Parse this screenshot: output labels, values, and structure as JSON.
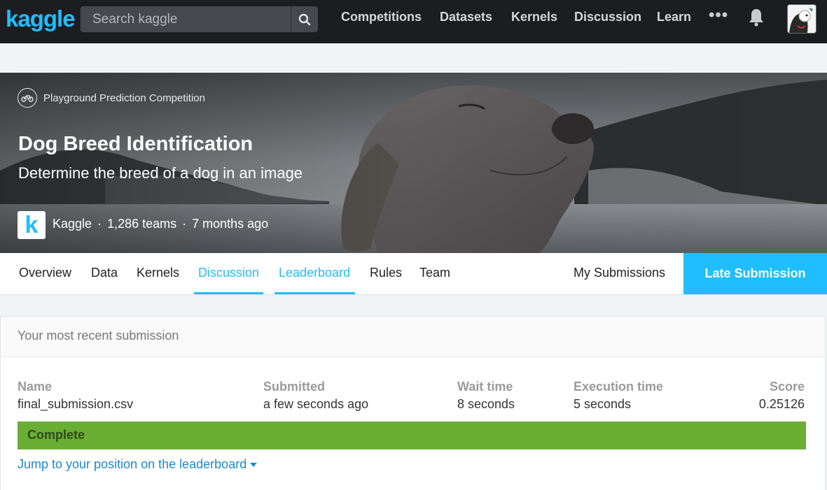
{
  "nav": {
    "logo": "kaggle",
    "search_placeholder": "Search kaggle",
    "links": [
      "Competitions",
      "Datasets",
      "Kernels",
      "Discussion",
      "Learn"
    ],
    "more": "•••"
  },
  "competition": {
    "type": "Playground Prediction Competition",
    "title": "Dog Breed Identification",
    "subtitle": "Determine the breed of a dog in an image",
    "host_logo": "k",
    "host": "Kaggle",
    "teams": "1,286 teams",
    "age": "7 months ago"
  },
  "tabs": {
    "items": [
      "Overview",
      "Data",
      "Kernels",
      "Discussion",
      "Leaderboard",
      "Rules",
      "Team"
    ],
    "my_submissions": "My Submissions",
    "late_submission": "Late Submission"
  },
  "submission": {
    "header": "Your most recent submission",
    "columns": {
      "name": "Name",
      "submitted": "Submitted",
      "wait": "Wait time",
      "execution": "Execution time",
      "score": "Score"
    },
    "values": {
      "name": "final_submission.csv",
      "submitted": "a few seconds ago",
      "wait": "8 seconds",
      "execution": "5 seconds",
      "score": "0.25126"
    },
    "status": "Complete",
    "jump_link": "Jump to your position on the leaderboard"
  },
  "colors": {
    "brand": "#20beff",
    "status_complete": "#6aae34",
    "topbar": "#1c1d20"
  }
}
